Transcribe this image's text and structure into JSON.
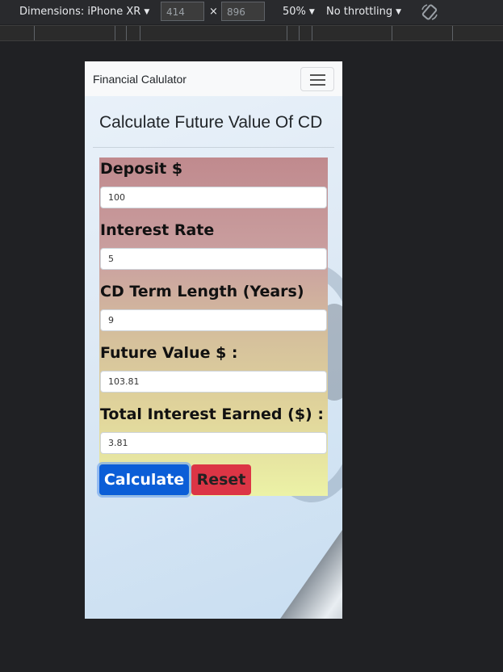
{
  "devtools": {
    "dimensions_label": "Dimensions: iPhone XR",
    "width": "414",
    "times": "×",
    "height": "896",
    "zoom": "50%",
    "throttling": "No throttling"
  },
  "navbar": {
    "brand": "Financial Calulator"
  },
  "page": {
    "title": "Calculate Future Value Of CD"
  },
  "form": {
    "deposit_label": "Deposit $",
    "deposit_value": "100",
    "rate_label": "Interest Rate",
    "rate_value": "5",
    "term_label": "CD Term Length (Years)",
    "term_value": "9",
    "future_label": "Future Value $ :",
    "future_value": "103.81",
    "interest_label": "Total Interest Earned ($) :",
    "interest_value": "3.81",
    "calculate_label": "Calculate",
    "reset_label": "Reset"
  },
  "colors": {
    "calculate": "#0b5ed7",
    "reset": "#dc3545"
  }
}
